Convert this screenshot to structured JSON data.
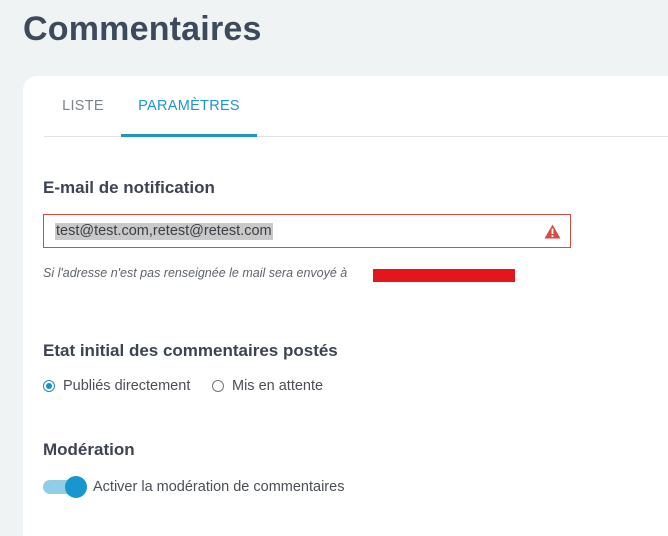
{
  "page": {
    "title": "Commentaires"
  },
  "tabs": [
    {
      "label": "LISTE",
      "active": false
    },
    {
      "label": "PARAMÈTRES",
      "active": true
    }
  ],
  "notification": {
    "title": "E-mail de notification",
    "value": "test@test.com,retest@retest.com",
    "error_icon": "warning-triangle-icon",
    "hint": "Si l'adresse n'est pas renseignée le mail sera envoyé à"
  },
  "initial_state": {
    "title": "Etat initial des commentaires postés",
    "options": [
      {
        "label": "Publiés directement",
        "selected": true
      },
      {
        "label": "Mis en attente",
        "selected": false
      }
    ]
  },
  "moderation": {
    "title": "Modération",
    "toggle_label": "Activer la modération de commentaires",
    "enabled": true
  },
  "colors": {
    "accent": "#1d97c7",
    "error": "#d94a42",
    "redaction": "#e3161b"
  }
}
